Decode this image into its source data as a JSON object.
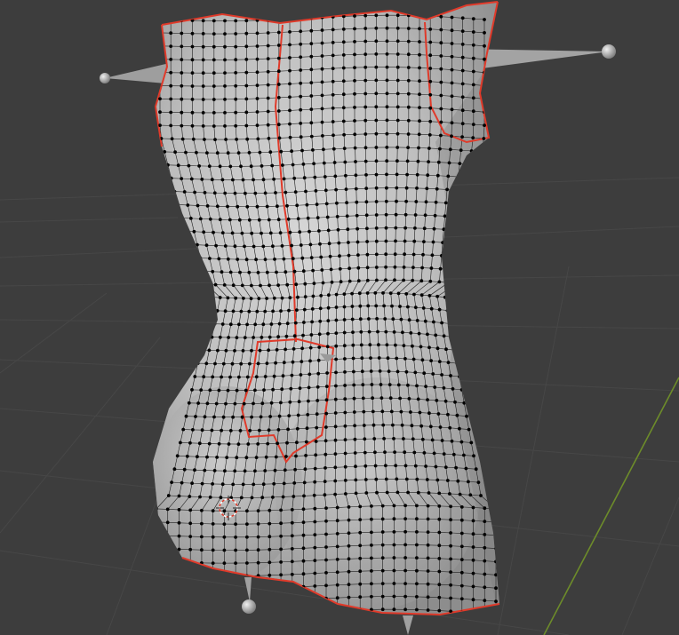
{
  "viewport": {
    "colors": {
      "background": "#3d3d3d",
      "grid_line": "#474747",
      "axis_y": "#6d8c2a",
      "mesh_fill": "#b9b9b9",
      "edge": "#1e1e1e",
      "vertex": "#000000",
      "seam": "#e03a2a",
      "gizmo": "#a8a8a8"
    },
    "objects": {
      "mesh": "torso-mesh",
      "empties": [
        "bone-empty-left",
        "bone-empty-right",
        "bone-empty-bottom-left",
        "bone-empty-bottom-right"
      ],
      "cursor": "3d-cursor-icon"
    }
  }
}
